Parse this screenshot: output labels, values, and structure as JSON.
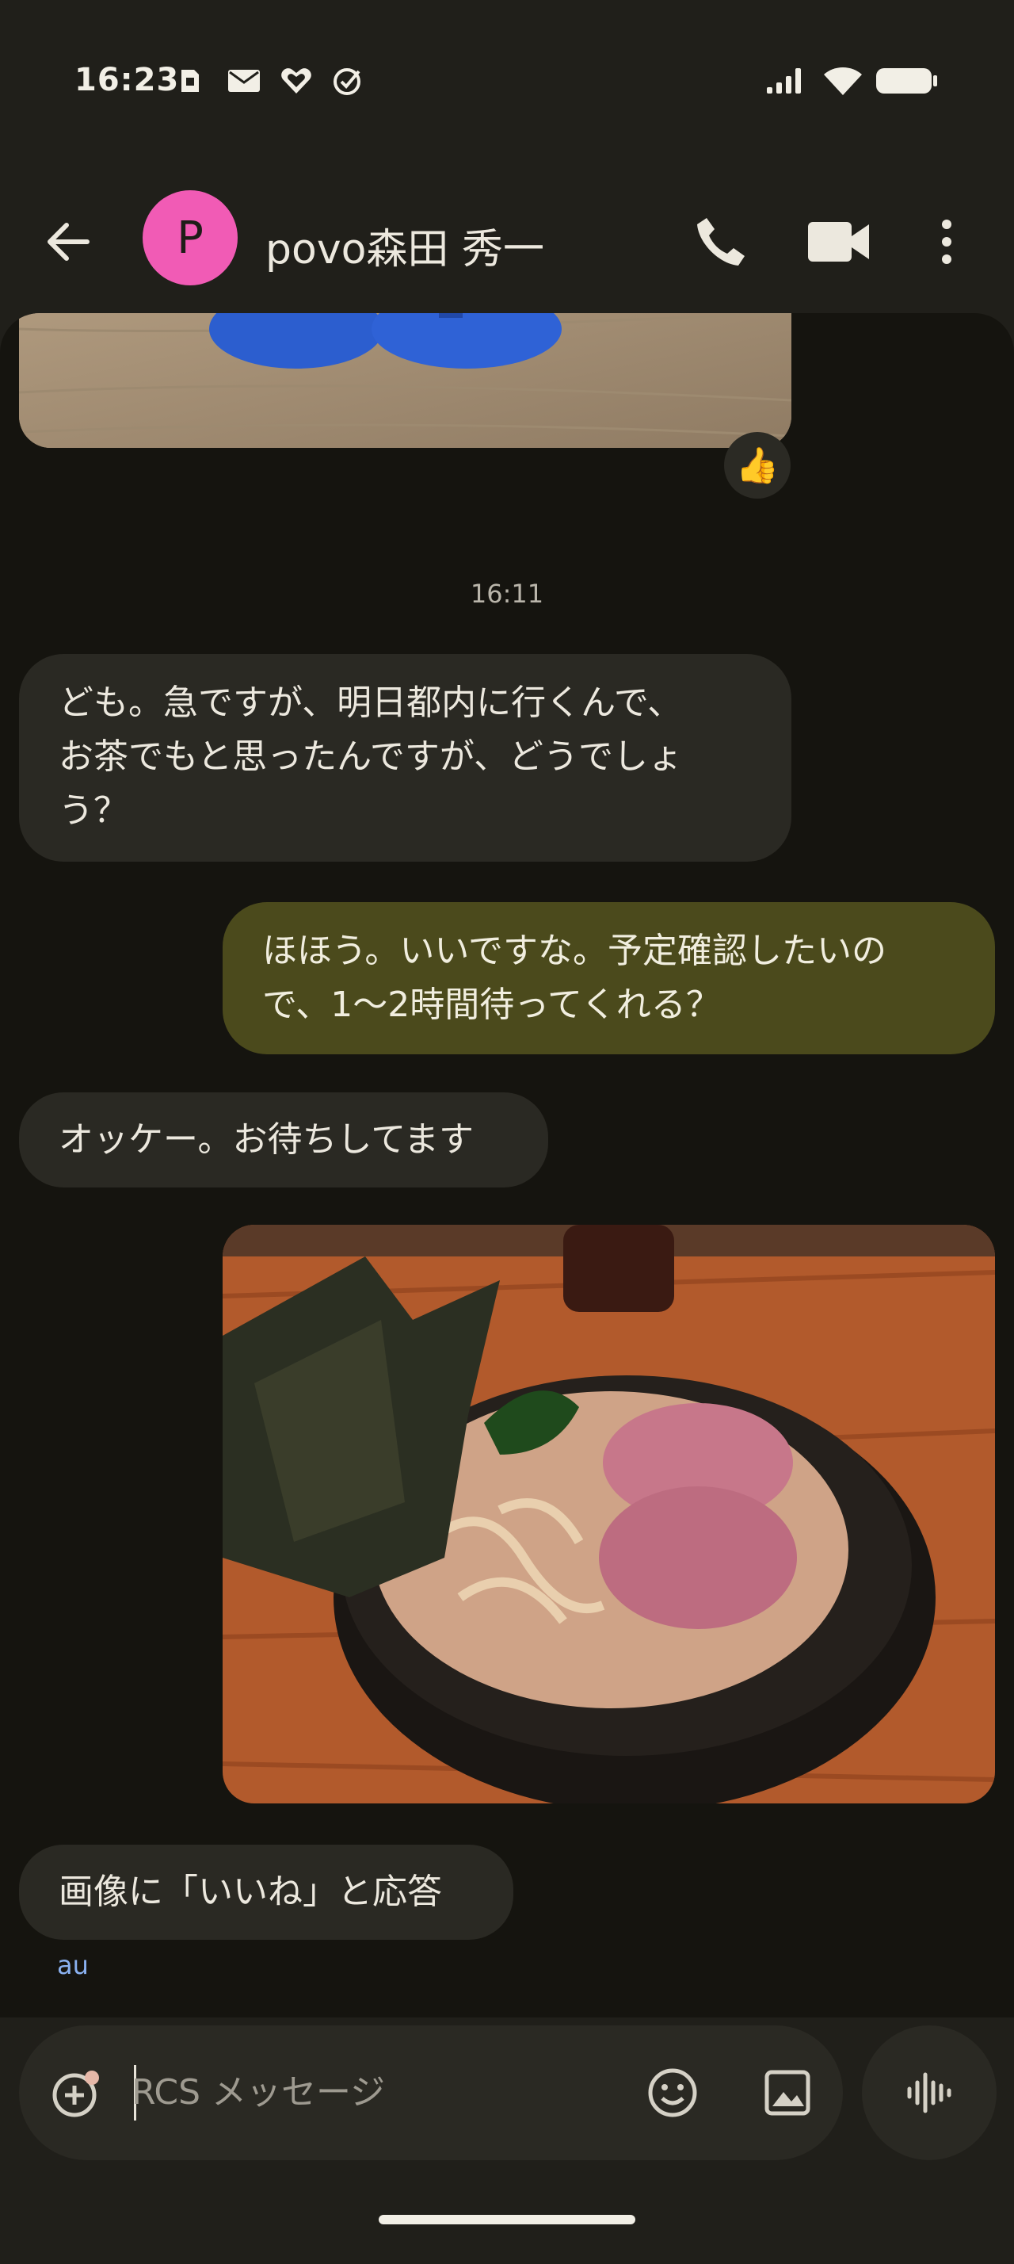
{
  "status_bar": {
    "time": "16:23"
  },
  "header": {
    "avatar_letter": "P",
    "contact_name": "povo森田 秀一"
  },
  "chat": {
    "reaction_emoji": "👍",
    "timestamp": "16:11",
    "messages": [
      {
        "direction": "incoming",
        "lines": [
          "ども。急ですが、明日都内に行くんで、",
          "お茶でもと思ったんですが、どうでしょ",
          "う？"
        ]
      },
      {
        "direction": "outgoing",
        "lines": [
          "ほほう。いいですな。予定確認したいの",
          "で、1〜2時間待ってくれる？"
        ]
      },
      {
        "direction": "incoming",
        "lines": [
          "オッケー。お待ちしてます"
        ]
      },
      {
        "direction": "outgoing",
        "type": "image"
      },
      {
        "direction": "incoming",
        "lines": [
          "画像に「いいね」と応答"
        ]
      }
    ],
    "carrier": "au"
  },
  "composer": {
    "placeholder": "RCS メッセージ"
  },
  "colors": {
    "background": "#201f1a",
    "chat_background": "#15140f",
    "incoming_bubble": "#2a2923",
    "outgoing_bubble": "#4b4a1c",
    "avatar": "#f15bb5",
    "carrier_text": "#8ab1f0"
  },
  "icons": [
    "sim-icon",
    "mail-icon",
    "heart-icon",
    "check-circle-icon",
    "signal-icon",
    "wifi-icon",
    "battery-icon",
    "back-arrow-icon",
    "phone-icon",
    "video-icon",
    "more-vert-icon",
    "add-icon",
    "emoji-icon",
    "gallery-icon",
    "voice-icon"
  ]
}
